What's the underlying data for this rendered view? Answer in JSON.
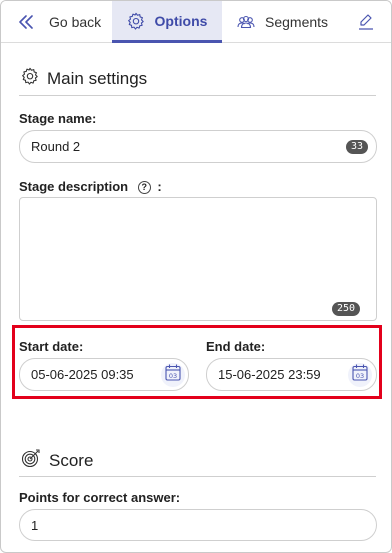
{
  "tabs": {
    "back_label": "Go back",
    "options_label": "Options",
    "segments_label": "Segments"
  },
  "main_settings": {
    "title": "Main settings",
    "stage_name_label": "Stage name:",
    "stage_name_value": "Round 2",
    "stage_name_counter": "33",
    "stage_description_label": "Stage description",
    "stage_description_label_suffix": ":",
    "stage_description_value": "",
    "stage_description_counter": "250",
    "start_date_label": "Start date:",
    "start_date_value": "05-06-2025 09:35",
    "end_date_label": "End date:",
    "end_date_value": "15-06-2025 23:59",
    "calendar_day": "03"
  },
  "score": {
    "title": "Score",
    "points_label": "Points for correct answer:",
    "points_value": "1"
  },
  "colors": {
    "accent": "#4a55b0",
    "active_tab_bg": "#e6e8f4",
    "highlight": "#e3001b"
  },
  "icons": [
    "back-arrow-icon",
    "gear-icon",
    "segments-icon",
    "pen-icon",
    "help-icon",
    "calendar-icon",
    "target-icon"
  ]
}
